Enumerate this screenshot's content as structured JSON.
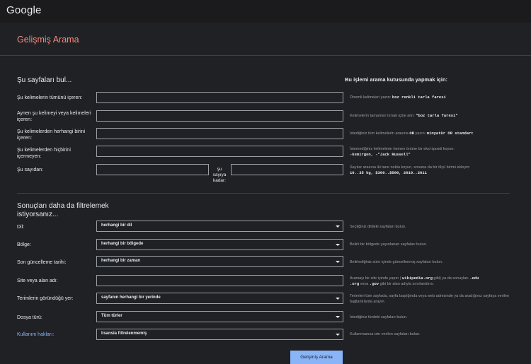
{
  "app": {
    "logo": "Google",
    "title": "Gelişmiş Arama"
  },
  "find_section": {
    "heading": "Şu sayfaları bul...",
    "right_heading": "Bu işlemi arama kutusunda yapmak için:",
    "fields": [
      {
        "label": "Şu kelimelerin tümünü içeren:",
        "value": "",
        "hint_pre": "Önemli kelimeleri yazın: ",
        "hint_code": "boz renkli tarla faresi",
        "hint_post": ""
      },
      {
        "label": "Aynen şu kelimeyi veya kelimeleri içeren:",
        "value": "",
        "hint_pre": "Kelimelerin tamamını tırnak içine alın: ",
        "hint_code": "\"boz tarla faresi\"",
        "hint_post": ""
      },
      {
        "label": "Şu kelimelerden herhangi birini içeren:",
        "value": "",
        "hint_pre": "İstediğiniz tüm kelimelerin arasına ",
        "hint_code": "OR",
        "hint_mid": " yazın: ",
        "hint_code2": "minyatür OR standart"
      },
      {
        "label": "Şu kelimelerden hiçbirini içermeyen:",
        "value": "",
        "hint_pre": "İstemediğiniz kelimelerin hemen önüne bir eksi işareti koyun: ",
        "hint_code": "-kemirgen, -\"Jack Russell\"",
        "hint_post": ""
      }
    ],
    "range": {
      "label": "Şu sayıdan:",
      "between": "şu sayıya kadar:",
      "from_value": "",
      "to_value": "",
      "hint_pre": "Sayılar arasına iki tane nokta koyun, sonuna da bir ölçü birimi ekleyin: ",
      "hint_code": "10..35 kg, $300..$500, 2010..2011"
    }
  },
  "filter_section": {
    "heading": "Sonuçları daha da filtrelemek istiyorsanız...",
    "rows": [
      {
        "label": "Dil:",
        "value": "herhangi bir dil",
        "hint": "Seçtiğiniz dildeki sayfaları bulun."
      },
      {
        "label": "Bölge:",
        "value": "herhangi bir bölgede",
        "hint": "Belirli bir bölgede yayınlanan sayfaları bulun."
      },
      {
        "label": "Son güncelleme tarihi:",
        "value": "herhangi bir zaman",
        "hint": "Belirlediğiniz süre içinde güncellenmiş sayfaları bulun."
      },
      {
        "label": "Terimlerin göründüğü yer:",
        "value": "sayfanın herhangi bir yerinde",
        "hint": "Terimleri tüm sayfada, sayfa başlığında veya web adresinde ya da aradığınız sayfaya verilen bağlantılarda arayın."
      },
      {
        "label": "Dosya türü:",
        "value": "Tüm türler",
        "hint": "İstediğiniz türdeki sayfaları bulun."
      },
      {
        "label": "Kullanım hakları:",
        "value": "lisansla filtrelenmemiş",
        "hint": "Kullanmanıza izin verilen sayfaları bulun."
      }
    ],
    "site": {
      "label": "Site veya alan adı:",
      "value": "",
      "hint_pre": "Aramayı bir site içinde yapın ( ",
      "hint_code": "wikipedia.org",
      "hint_mid": " gibi) ya da sonuçları ",
      "hint_code2": ".edu",
      "hint_sep": ", ",
      "hint_code3": ".org",
      "hint_mid2": " veya ",
      "hint_code4": ".gov",
      "hint_post": " gibi bir alan adıyla sınırlandırın."
    }
  },
  "submit_label": "Gelişmiş Arama"
}
